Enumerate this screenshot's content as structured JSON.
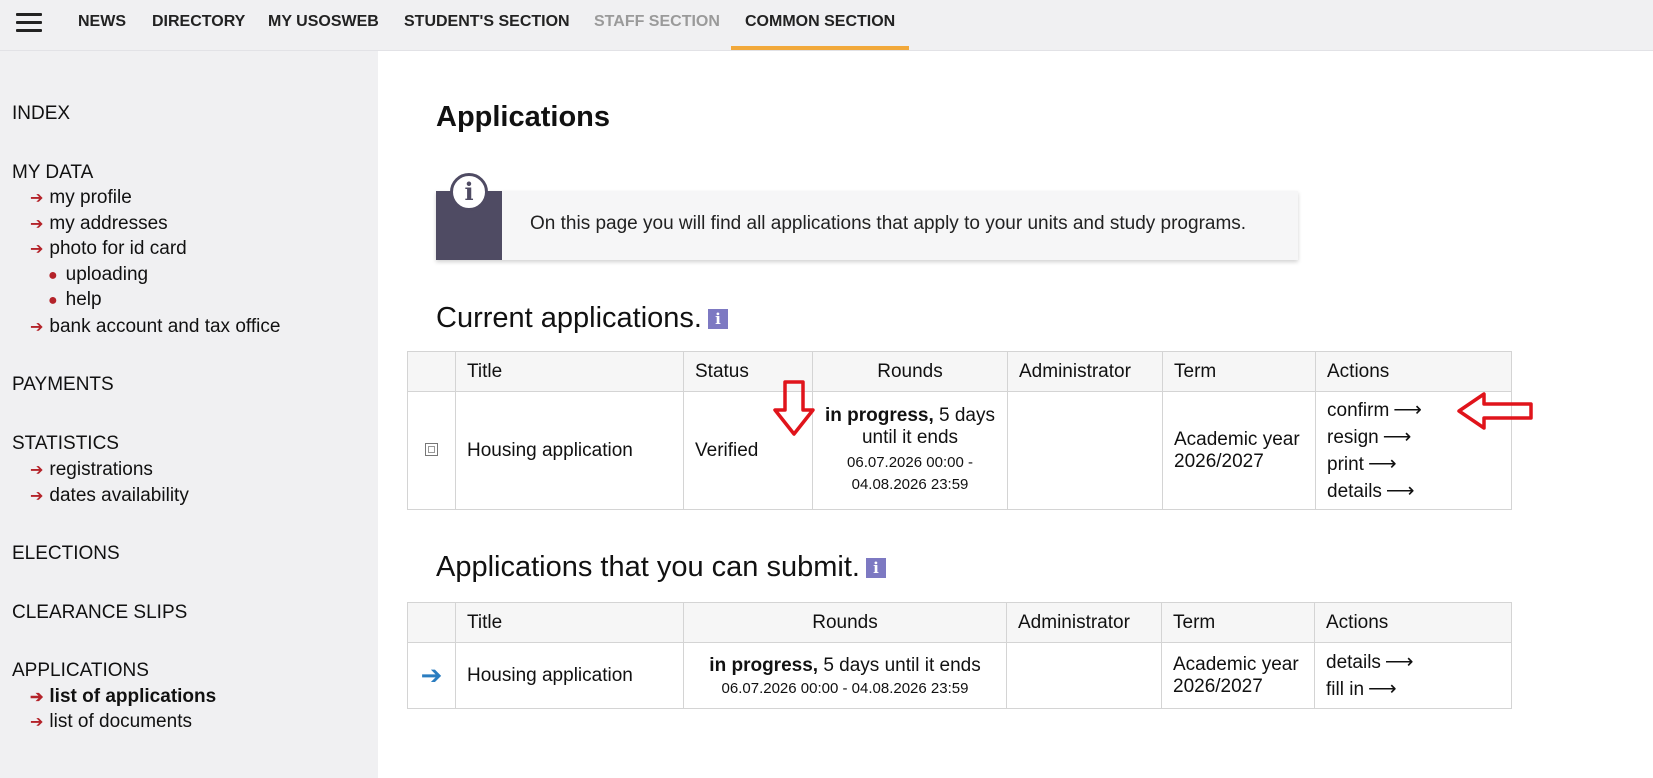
{
  "nav": {
    "menu_icon": "hamburger-icon",
    "items": [
      "NEWS",
      "DIRECTORY",
      "MY USOSWEB",
      "STUDENT'S SECTION",
      "STAFF SECTION",
      "COMMON SECTION"
    ],
    "active": "COMMON SECTION",
    "disabled": "STAFF SECTION",
    "active_underline_color": "#f2a93b"
  },
  "sidebar": {
    "index": "INDEX",
    "my_data": {
      "title": "MY DATA",
      "links": [
        "my profile",
        "my addresses",
        "photo for id card"
      ],
      "photo_sub": [
        "uploading",
        "help"
      ],
      "bank": "bank account and tax office"
    },
    "payments": "PAYMENTS",
    "statistics": {
      "title": "STATISTICS",
      "links": [
        "registrations",
        "dates availability"
      ]
    },
    "elections": "ELECTIONS",
    "clearance": "CLEARANCE SLIPS",
    "applications": {
      "title": "APPLICATIONS",
      "links": [
        "list of applications",
        "list of documents"
      ],
      "selected": "list of applications"
    }
  },
  "main": {
    "title": "Applications",
    "info_text": "On this page you will find all applications that apply to your units and study programs.",
    "current": {
      "heading": "Current applications.",
      "headers": [
        "Title",
        "Status",
        "Rounds",
        "Administrator",
        "Term",
        "Actions"
      ],
      "row": {
        "title": "Housing application",
        "status": "Verified",
        "rounds_bold": "in progress,",
        "rounds_rest": " 5 days until it ends",
        "rounds_dates": "06.07.2026 00:00 - 04.08.2026 23:59",
        "administrator": "",
        "term": "Academic year 2026/2027",
        "actions": [
          "confirm",
          "resign",
          "print",
          "details"
        ]
      }
    },
    "submit": {
      "heading": "Applications that you can submit.",
      "headers": [
        "Title",
        "Rounds",
        "Administrator",
        "Term",
        "Actions"
      ],
      "row": {
        "title": "Housing application",
        "rounds_bold": "in progress,",
        "rounds_rest": " 5 days until it ends",
        "rounds_dates": "06.07.2026 00:00 - 04.08.2026 23:59",
        "administrator": "",
        "term": "Academic year 2026/2027",
        "actions": [
          "details",
          "fill in"
        ]
      }
    }
  },
  "colors": {
    "annotation": "#e0141b",
    "info_sidebar": "#4f4b63",
    "help_badge": "#7d79c2"
  }
}
